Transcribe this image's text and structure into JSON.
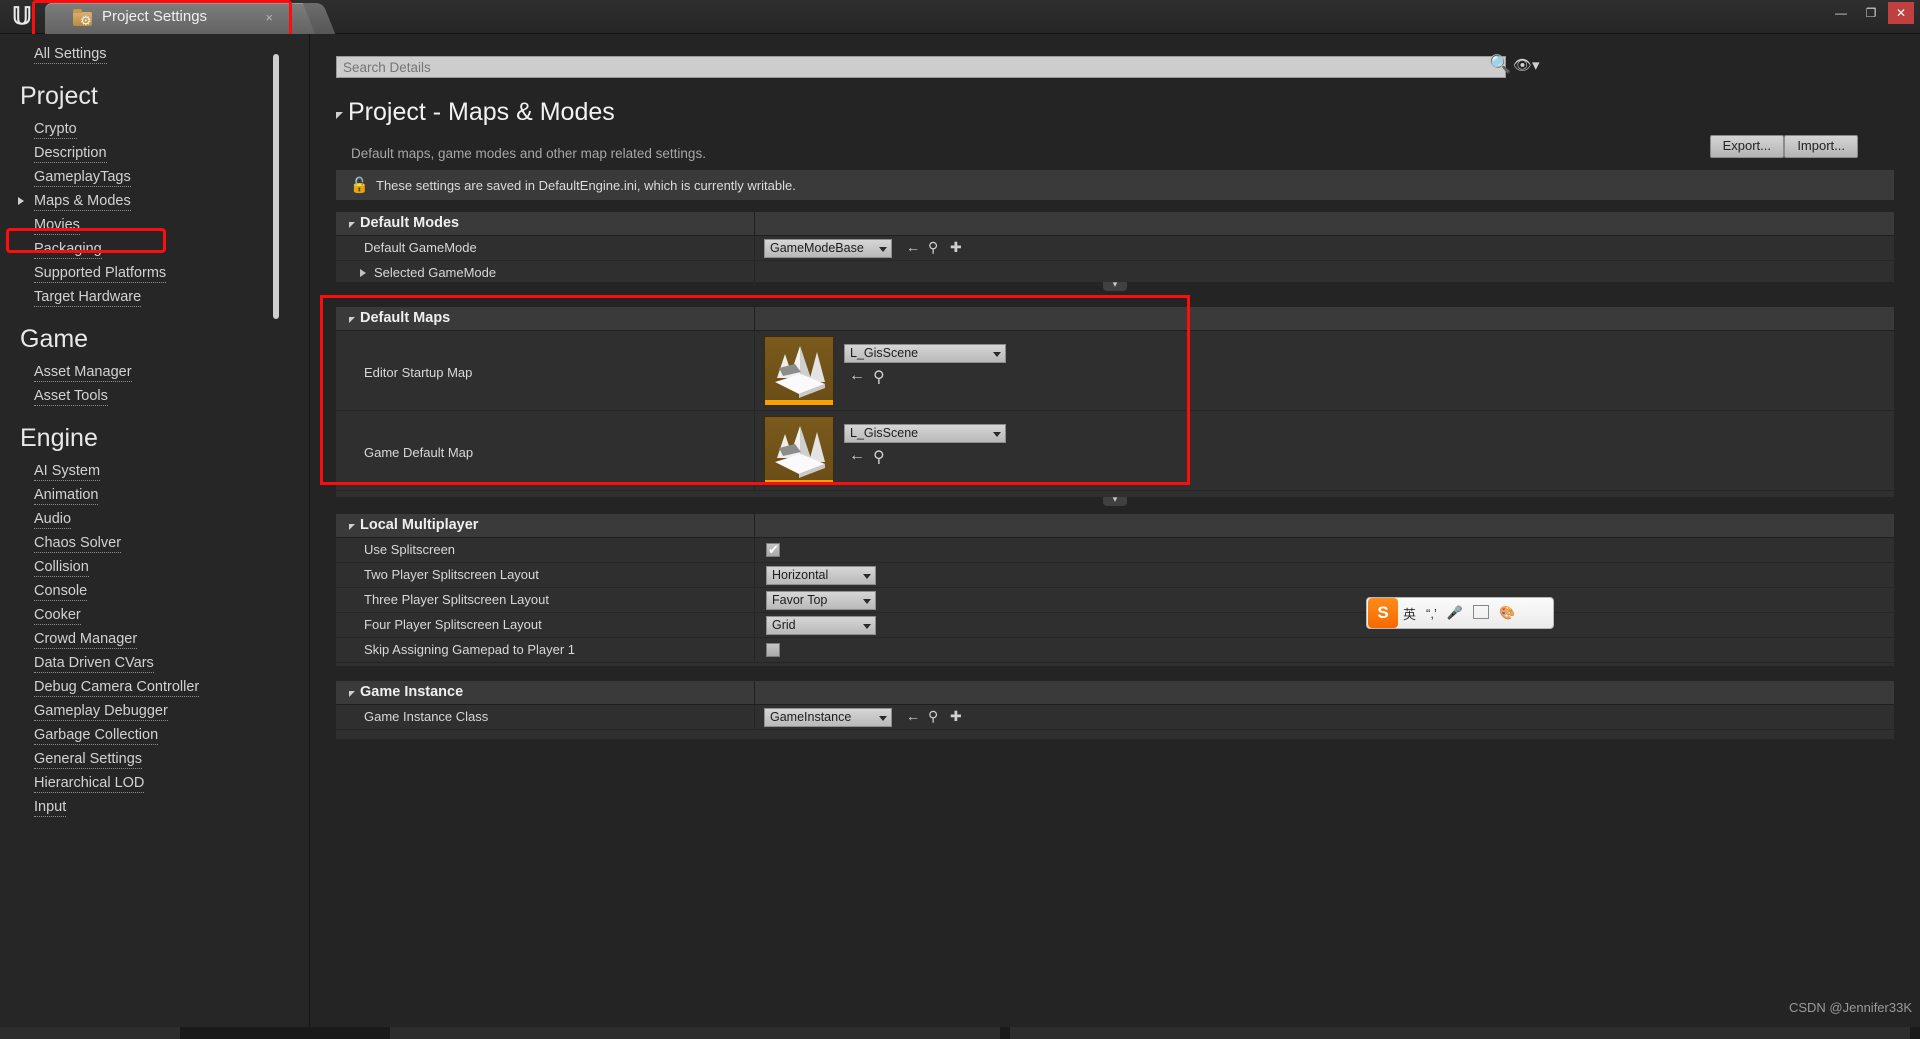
{
  "window": {
    "tab_title": "Project Settings",
    "tab_close": "×",
    "minimize": "—",
    "maximize": "❐",
    "close": "✕"
  },
  "sidebar": {
    "all_settings": "All Settings",
    "groups": [
      {
        "header": "Project",
        "items": [
          {
            "label": "Crypto",
            "selected": false
          },
          {
            "label": "Description",
            "selected": false
          },
          {
            "label": "GameplayTags",
            "selected": false
          },
          {
            "label": "Maps & Modes",
            "selected": true
          },
          {
            "label": "Movies",
            "selected": false
          },
          {
            "label": "Packaging",
            "selected": false
          },
          {
            "label": "Supported Platforms",
            "selected": false
          },
          {
            "label": "Target Hardware",
            "selected": false
          }
        ]
      },
      {
        "header": "Game",
        "items": [
          {
            "label": "Asset Manager",
            "selected": false
          },
          {
            "label": "Asset Tools",
            "selected": false
          }
        ]
      },
      {
        "header": "Engine",
        "items": [
          {
            "label": "AI System",
            "selected": false
          },
          {
            "label": "Animation",
            "selected": false
          },
          {
            "label": "Audio",
            "selected": false
          },
          {
            "label": "Chaos Solver",
            "selected": false
          },
          {
            "label": "Collision",
            "selected": false
          },
          {
            "label": "Console",
            "selected": false
          },
          {
            "label": "Cooker",
            "selected": false
          },
          {
            "label": "Crowd Manager",
            "selected": false
          },
          {
            "label": "Data Driven CVars",
            "selected": false
          },
          {
            "label": "Debug Camera Controller",
            "selected": false
          },
          {
            "label": "Gameplay Debugger",
            "selected": false
          },
          {
            "label": "Garbage Collection",
            "selected": false
          },
          {
            "label": "General Settings",
            "selected": false
          },
          {
            "label": "Hierarchical LOD",
            "selected": false
          },
          {
            "label": "Input",
            "selected": false
          }
        ]
      }
    ]
  },
  "search": {
    "placeholder": "Search Details",
    "value": "",
    "icon": "search-icon",
    "eye_icon": "eye-icon"
  },
  "header": {
    "title": "Project - Maps & Modes",
    "subtitle": "Default maps, game modes and other map related settings.",
    "export_label": "Export...",
    "import_label": "Import..."
  },
  "notice": {
    "icon": "unlocked-padlock-icon",
    "text": "These settings are saved in DefaultEngine.ini, which is currently writable."
  },
  "sections": [
    {
      "name": "Default Modes",
      "rows": [
        {
          "label": "Default GameMode",
          "control": "combo",
          "value": "GameModeBase",
          "actions": [
            "reset-arrow-icon",
            "browse-icon",
            "plus-icon"
          ]
        },
        {
          "label": "Selected GameMode",
          "control": "expander",
          "value": "",
          "actions": []
        }
      ]
    },
    {
      "name": "Default Maps",
      "rows": [
        {
          "label": "Editor Startup Map",
          "control": "asset",
          "value": "L_GisScene",
          "actions": [
            "reset-arrow-icon",
            "browse-icon"
          ]
        },
        {
          "label": "Game Default Map",
          "control": "asset",
          "value": "L_GisScene",
          "actions": [
            "reset-arrow-icon",
            "browse-icon"
          ]
        }
      ]
    },
    {
      "name": "Local Multiplayer",
      "rows": [
        {
          "label": "Use Splitscreen",
          "control": "checkbox",
          "value": "checked",
          "actions": []
        },
        {
          "label": "Two Player Splitscreen Layout",
          "control": "combo",
          "value": "Horizontal",
          "actions": []
        },
        {
          "label": "Three Player Splitscreen Layout",
          "control": "combo",
          "value": "Favor Top",
          "actions": []
        },
        {
          "label": "Four Player Splitscreen Layout",
          "control": "combo",
          "value": "Grid",
          "actions": []
        },
        {
          "label": "Skip Assigning Gamepad to Player 1",
          "control": "checkbox",
          "value": "unchecked",
          "actions": []
        }
      ]
    },
    {
      "name": "Game Instance",
      "rows": [
        {
          "label": "Game Instance Class",
          "control": "combo",
          "value": "GameInstance",
          "actions": [
            "reset-arrow-icon",
            "browse-icon",
            "plus-icon"
          ]
        }
      ]
    }
  ],
  "ime": {
    "logo": "S",
    "mode": "英",
    "comma": "“,’",
    "mic_icon": "microphone-icon",
    "keyboard_icon": "keyboard-icon",
    "palette_icon": "palette-icon",
    "apps_icon": "apps-grid-icon"
  },
  "watermark": "CSDN @Jennifer33K",
  "highlight_color": "#fd0d0d"
}
